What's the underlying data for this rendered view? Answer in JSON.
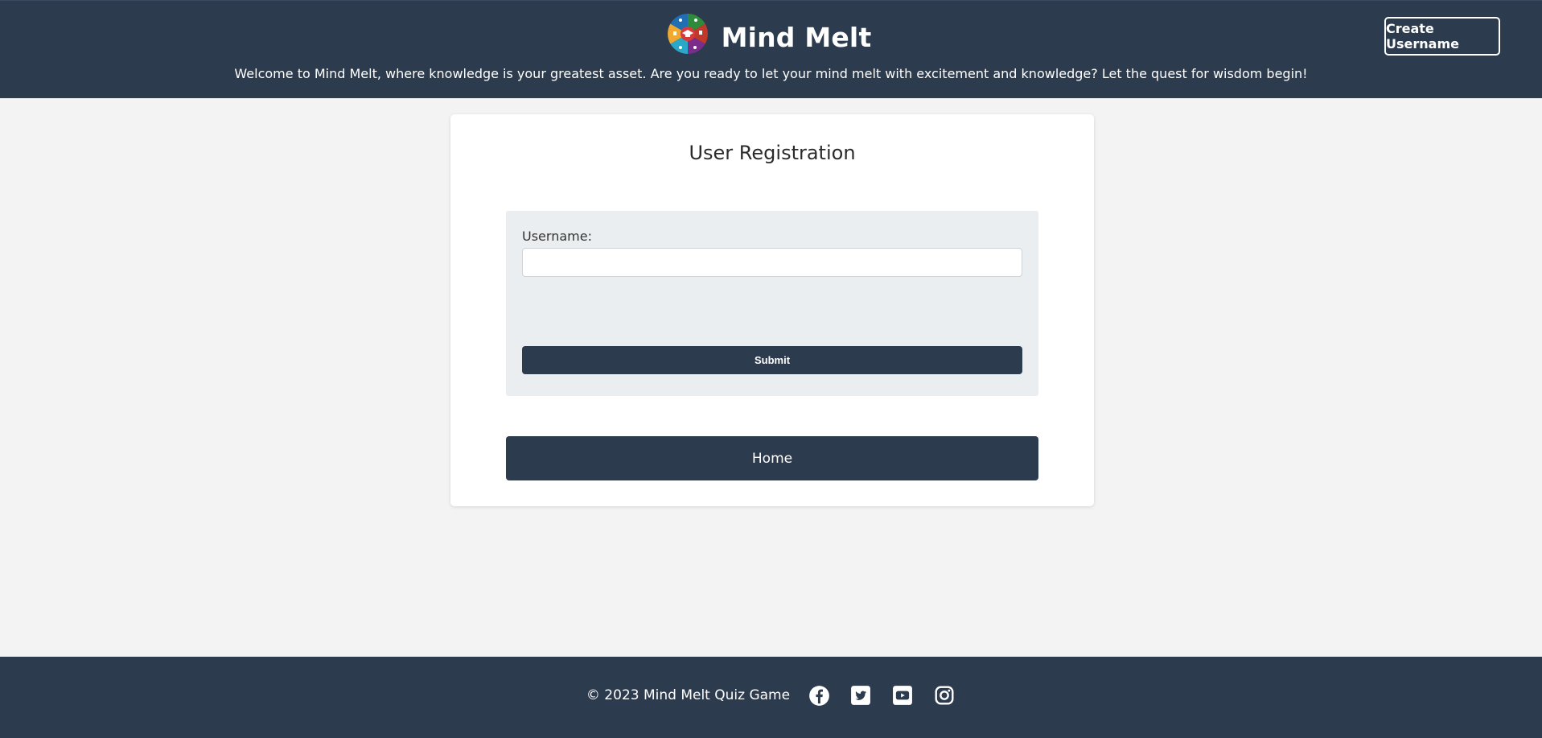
{
  "header": {
    "title": "Mind Melt",
    "tagline": "Welcome to Mind Melt, where knowledge is your greatest asset. Are you ready to let your mind melt with excitement and knowledge? Let the quest for wisdom begin!",
    "create_username_label": "Create Username",
    "logo_icon": "quiz-categories-logo-icon"
  },
  "registration": {
    "title": "User Registration",
    "username_label": "Username:",
    "username_value": "",
    "username_placeholder": "",
    "submit_label": "Submit",
    "home_label": "Home"
  },
  "footer": {
    "copyright": "© 2023 Mind Melt Quiz Game",
    "social_icons": [
      "facebook-icon",
      "twitter-icon",
      "youtube-icon",
      "instagram-icon"
    ]
  },
  "colors": {
    "primary": "#2d3b4e",
    "background": "#f3f3f3",
    "panel": "#ebeef0",
    "card": "#ffffff",
    "text_on_dark": "#ffffff"
  }
}
